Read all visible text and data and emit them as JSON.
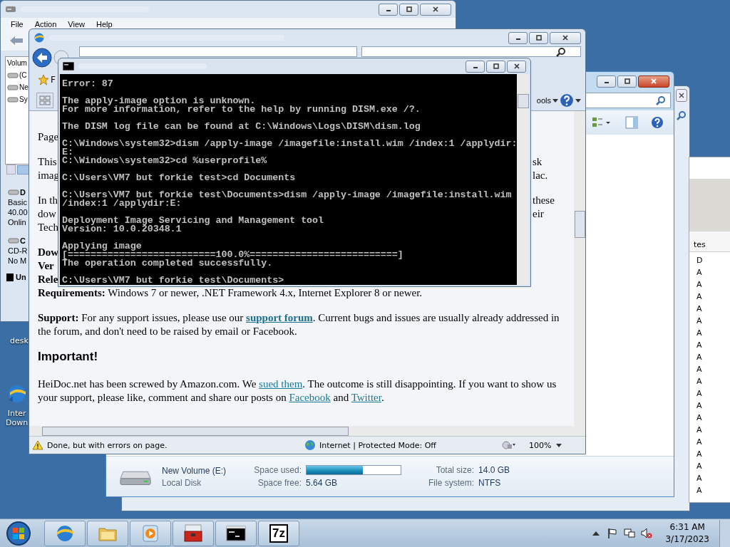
{
  "desktop_icons": [
    {
      "lines": [
        "desk"
      ]
    },
    {
      "lines": [
        "Inter",
        "Down"
      ]
    }
  ],
  "disk_management": {
    "menu": [
      "File",
      "Action",
      "View",
      "Help"
    ],
    "volume_header": "Volum",
    "volumes": [
      "(C",
      "Ne",
      "Sy"
    ],
    "disks": [
      {
        "name": "D",
        "lines": [
          "Basic",
          "40.00",
          "Onlin"
        ]
      },
      {
        "name": "C",
        "lines": [
          "CD-R",
          "No M"
        ]
      }
    ],
    "legend": "Un"
  },
  "browser": {
    "favorites": "F",
    "tools": "ools",
    "status": "Done, but with errors on page.",
    "zone": "Internet | Protected Mode: Off",
    "zoom": "100%",
    "fragment_paragraphs": [
      [
        {
          "left": "Page"
        }
      ],
      [
        {
          "left": "This",
          "right": "sk"
        },
        {
          "left": "imag",
          "right": "lac."
        }
      ],
      [
        {
          "left": "In th",
          "right": "these"
        },
        {
          "left": "dow",
          "right": "eir"
        },
        {
          "left": "Tech"
        }
      ],
      [
        {
          "left": "Dow",
          "bold": true
        },
        {
          "left": "Ver",
          "bold": true
        },
        {
          "left": "Rele",
          "bold": true
        },
        {
          "text": "**Requirements:**  Windows 7 or newer, .NET Framework 4.x, Internet Explorer 8 or newer."
        }
      ]
    ],
    "paragraphs": [
      [
        {
          "kind": "bold",
          "text": "Support:"
        },
        {
          "kind": "plain",
          "text": " For any support issues, please use our "
        },
        {
          "kind": "strong_link",
          "text": "support forum"
        },
        {
          "kind": "plain",
          "text": ". Current bugs and issues are usually already addressed in the forum, and don't need to be raised by email or Facebook."
        }
      ],
      [
        {
          "kind": "heading",
          "text": "Important!"
        }
      ],
      [
        {
          "kind": "plain",
          "text": "HeiDoc.net has been screwed by Amazon.com. We "
        },
        {
          "kind": "link",
          "text": "sued them"
        },
        {
          "kind": "plain",
          "text": ". The outcome is still disappointing. If you want to show us your support, please like, comment and share our posts on "
        },
        {
          "kind": "link",
          "text": "Facebook"
        },
        {
          "kind": "plain",
          "text": " and "
        },
        {
          "kind": "link",
          "text": "Twitter"
        },
        {
          "kind": "plain",
          "text": "."
        }
      ]
    ]
  },
  "console": {
    "groups": [
      [
        "Error: 87"
      ],
      [
        "The apply-image option is unknown.",
        "For more information, refer to the help by running DISM.exe /?."
      ],
      [
        "The DISM log file can be found at C:\\Windows\\Logs\\DISM\\dism.log"
      ],
      [
        "C:\\Windows\\system32>dism /apply-image /imagefile:install.wim /index:1 /applydir:",
        "E:",
        "C:\\Windows\\system32>cd %userprofile%"
      ],
      [
        "C:\\Users\\VM7 but forkie test>cd Documents"
      ],
      [
        "C:\\Users\\VM7 but forkie test\\Documents>dism /apply-image /imagefile:install.wim",
        "/index:1 /applydir:E:"
      ],
      [
        "Deployment Image Servicing and Management tool",
        "Version: 10.0.20348.1"
      ],
      [
        "Applying image",
        "[==========================100.0%==========================]",
        "The operation completed successfully."
      ],
      [
        "C:\\Users\\VM7 but forkie test\\Documents>"
      ]
    ]
  },
  "drive_details": {
    "name": "New Volume (E:)",
    "type": "Local Disk",
    "used_label": "Space used:",
    "level": 0.6,
    "free_label": "Space free:",
    "free": "5.64 GB",
    "total_label": "Total size:",
    "total": "14.0 GB",
    "fs_label": "File system:",
    "fs": "NTFS"
  },
  "attributes_list": {
    "header": "tes",
    "cells": [
      "D",
      "A",
      "A",
      "A",
      "A",
      "A",
      "A",
      "A",
      "A",
      "A",
      "A",
      "A",
      "A",
      "A",
      "A",
      "A",
      "A",
      "A",
      "A",
      "A"
    ]
  },
  "taskbar": {
    "apps": [
      {
        "kind": "ie"
      },
      {
        "kind": "folder"
      },
      {
        "kind": "media"
      },
      {
        "kind": "toolbox"
      },
      {
        "kind": "console"
      },
      {
        "kind": "archive",
        "label": "7z"
      }
    ],
    "clock": {
      "time": "6:31 AM",
      "date": "3/17/2023"
    }
  }
}
